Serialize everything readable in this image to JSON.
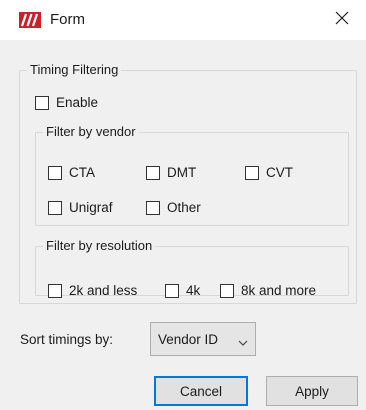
{
  "window": {
    "title": "Form",
    "icon": "red-slash-logo-icon",
    "close_symbol": "✕"
  },
  "timing_group": {
    "title": "Timing Filtering",
    "enable": {
      "label": "Enable",
      "checked": false
    }
  },
  "vendor_group": {
    "title": "Filter by vendor",
    "options": [
      {
        "label": "CTA",
        "checked": false
      },
      {
        "label": "DMT",
        "checked": false
      },
      {
        "label": "CVT",
        "checked": false
      },
      {
        "label": "Unigraf",
        "checked": false
      },
      {
        "label": "Other",
        "checked": false
      }
    ]
  },
  "resolution_group": {
    "title": "Filter by resolution",
    "options": [
      {
        "label": "2k and less",
        "checked": false
      },
      {
        "label": "4k",
        "checked": false
      },
      {
        "label": "8k and more",
        "checked": false
      }
    ]
  },
  "sort": {
    "label": "Sort timings by:",
    "selected": "Vendor ID"
  },
  "buttons": {
    "cancel": "Cancel",
    "apply": "Apply"
  },
  "colors": {
    "brand": "#cc1f2b",
    "focus_border": "#0078d7",
    "dialog_bg": "#f0f0f0",
    "button_bg": "#e1e1e1"
  }
}
